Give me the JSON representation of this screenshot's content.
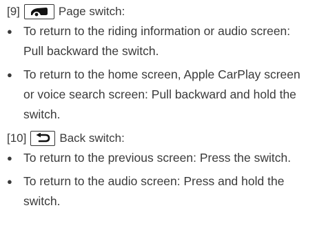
{
  "items": [
    {
      "number": "[9]",
      "icon": "page-switch-icon",
      "label": "Page switch:",
      "bullets": [
        "To return to the riding information or audio screen: Pull backward the switch.",
        "To return to the home screen, Apple CarPlay screen or voice search screen: Pull backward and hold the switch."
      ]
    },
    {
      "number": "[10]",
      "icon": "back-arrow-icon",
      "label": "Back switch:",
      "bullets": [
        "To return to the previous screen: Press the switch.",
        "To return to the audio screen: Press and hold the switch."
      ]
    }
  ]
}
